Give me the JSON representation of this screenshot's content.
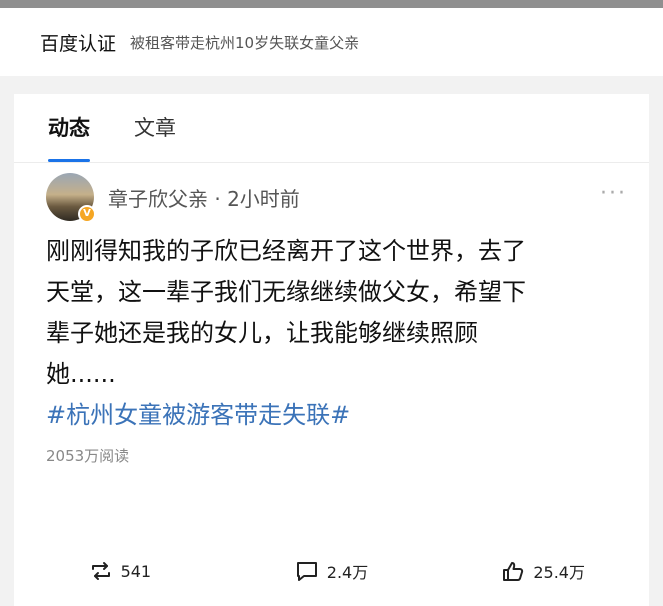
{
  "cert": {
    "title": "百度认证",
    "text": "被租客带走杭州10岁失联女童父亲"
  },
  "tabs": [
    {
      "label": "动态",
      "active": true
    },
    {
      "label": "文章",
      "active": false
    }
  ],
  "post": {
    "author_line": "章子欣父亲 · 2小时前",
    "more": "···",
    "body_lines": [
      "刚刚得知我的子欣已经离开了这个世界，去了",
      "天堂，这一辈子我们无缘继续做父女，希望下",
      "辈子她还是我的女儿，让我能够继续照顾",
      "她......"
    ],
    "hashtag": "#杭州女童被游客带走失联#",
    "reads": "2053万阅读"
  },
  "actions": {
    "repost": {
      "icon": "repost-icon",
      "count": "541"
    },
    "comment": {
      "icon": "comment-icon",
      "count": "2.4万"
    },
    "like": {
      "icon": "thumbs-up-icon",
      "count": "25.4万"
    }
  },
  "colors": {
    "accent": "#1a73e8",
    "hashtag": "#3b73b8"
  }
}
